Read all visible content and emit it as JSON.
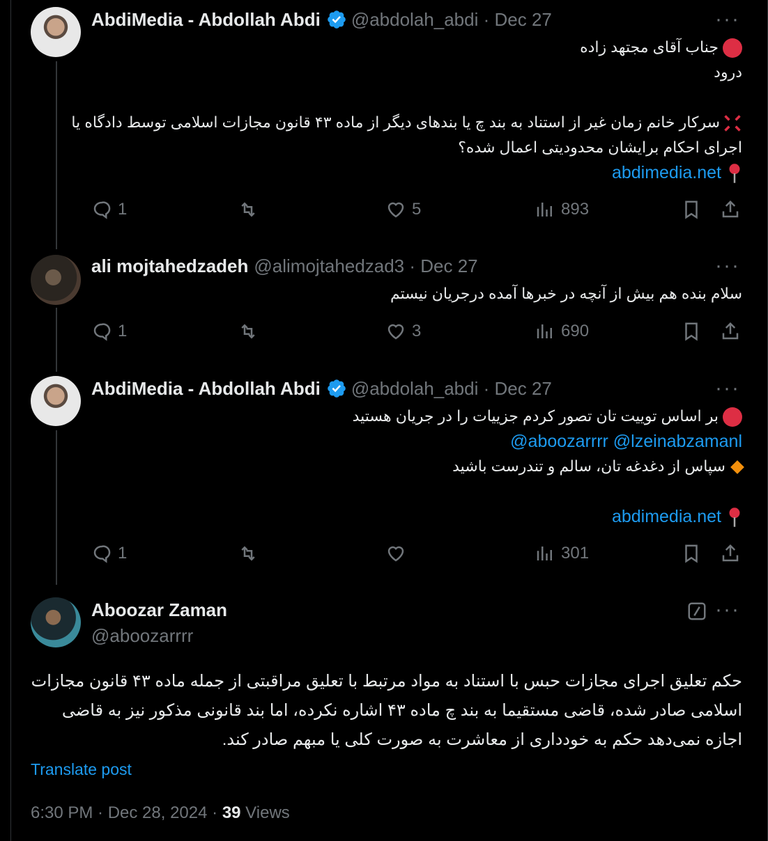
{
  "tweets": [
    {
      "name": "AbdiMedia - Abdollah Abdi",
      "handle": "@abdolah_abdi",
      "date": "Dec 27",
      "lines": [
        "جناب آقای مجتهد زاده",
        "درود",
        "سرکار خانم زمان غیر از استناد به بند چ یا بندهای دیگر از ماده ۴۳ قانون مجازات اسلامی توسط دادگاه یا",
        "اجرای احکام برایشان محدودیتی اعمال شده؟"
      ],
      "link": "abdimedia.net",
      "replies": "1",
      "likes": "5",
      "views": "893"
    },
    {
      "name": "ali mojtahedzadeh",
      "handle": "@alimojtahedzad3",
      "date": "Dec 27",
      "lines": [
        "سلام بنده هم بیش از آنچه در خبرها آمده درجریان نیستم"
      ],
      "replies": "1",
      "likes": "3",
      "views": "690"
    },
    {
      "name": "AbdiMedia - Abdollah Abdi",
      "handle": "@abdolah_abdi",
      "date": "Dec 27",
      "lines": [
        "بر اساس توییت تان تصور کردم جزییات را در جریان هستید",
        "سپاس از دغدغه تان، سالم و تندرست باشید"
      ],
      "mentions": "@aboozarrrr  @lzeinabzamanl",
      "link": "abdimedia.net",
      "replies": "1",
      "views": "301"
    }
  ],
  "main": {
    "name": "Aboozar Zaman",
    "handle": "@aboozarrrr",
    "lines": [
      "حکم تعلیق اجرای مجازات حبس با استناد به مواد مرتبط با تعلیق مراقبتی از جمله ماده ۴۳ قانون مجازات",
      "اسلامی صادر شده، قاضی مستقیما به بند چ ماده ۴۳ اشاره نکرده، اما بند قانونی مذکور نیز به قاضی",
      "اجازه نمی‌دهد حکم به خودداری از معاشرت به صورت کلی یا مبهم صادر کند."
    ],
    "translate": "Translate post",
    "time": "6:30 PM · Dec 28, 2024 · ",
    "views_count": "39",
    "views_label": " Views"
  },
  "colors": {
    "accent": "#1d9bf0",
    "muted": "#71767b",
    "text": "#e7e9ea",
    "background": "#000000"
  }
}
